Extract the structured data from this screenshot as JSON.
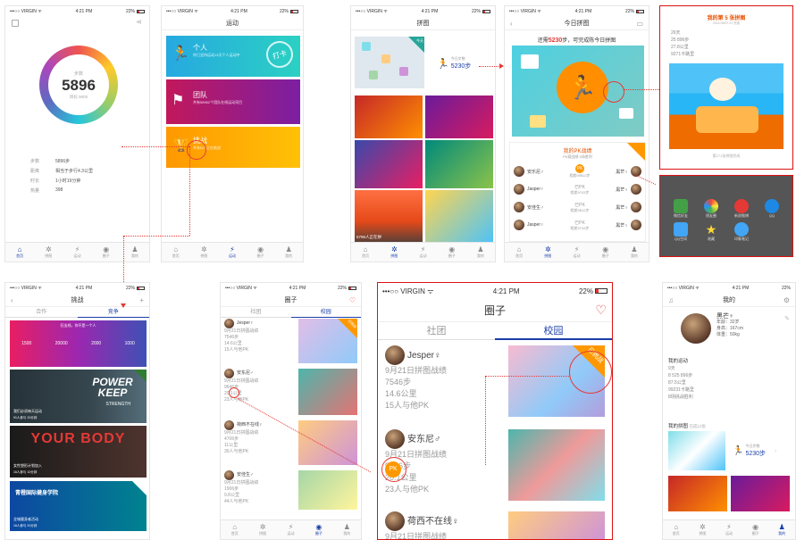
{
  "status": {
    "carrier": "•••○○ VIRGIN ᯤ",
    "time": "4:21 PM",
    "battery": "22%"
  },
  "tabs": [
    "首页",
    "拼图",
    "运动",
    "圈子",
    "我的"
  ],
  "home": {
    "steps": "5896",
    "steps_label": "步数",
    "goal": "目标 9000",
    "stats": [
      {
        "k": "步数",
        "v": "5896步"
      },
      {
        "k": "距离",
        "v": "相当于步行4.3公里"
      },
      {
        "k": "时长",
        "v": "1小时19分钟"
      },
      {
        "k": "热量",
        "v": "398"
      }
    ]
  },
  "sport": {
    "title": "运动",
    "cards": [
      {
        "title": "个人",
        "sub": "你已坚持运动13天个人运动中",
        "stamp": "打卡"
      },
      {
        "title": "团队",
        "sub": "共有58962个团队在线运动项目",
        "stamp": ""
      },
      {
        "title": "挑战",
        "sub": "共有N人正在挑战",
        "stamp": ""
      }
    ]
  },
  "puzzle": {
    "title": "拼图",
    "steps": "5230步",
    "steps_label": "今日步数",
    "badge": "今天",
    "bottom": "5796人正在拼"
  },
  "daily": {
    "title": "今日拼图",
    "banner_pre": "还需",
    "banner_num": "5230",
    "banner_post": "步，可完成陈今日拼图",
    "pk_title": "我的PK战绩",
    "pk_sub": "PK赛战绩 5场胜利",
    "pk_rows": [
      {
        "left": "安乐尼♂",
        "mid": "PK",
        "sub": "相差59812步",
        "right": "黑芒♀"
      },
      {
        "left": "Jasper♀",
        "mid": "已PK",
        "sub": "相差9743步",
        "right": "黑芒♀"
      },
      {
        "left": "安佳生♂",
        "mid": "已PK",
        "sub": "相差9812步",
        "right": "黑芒♀"
      },
      {
        "left": "Jasper♀",
        "mid": "已PK",
        "sub": "相差9743步",
        "right": "黑芒♀"
      }
    ]
  },
  "detail": {
    "title": "我的第 5 张拼图",
    "subtitle": "2014.09/07.21 完成",
    "stats": [
      "26天",
      "25 896步",
      "27.8公里",
      "9271卡路里"
    ],
    "footer": "第271张拼图完成",
    "share": [
      "微信好友",
      "朋友圈",
      "新浪微博",
      "QQ",
      "QQ空间",
      "收藏",
      "印象笔记"
    ]
  },
  "challenge": {
    "title": "挑战",
    "seg": [
      "合作",
      "竞争"
    ],
    "top_text": "狂出线，你不是一个人",
    "banners": [
      {
        "a": "1500",
        "b": "20000",
        "c": "2000",
        "d": "1000"
      },
      {
        "title": "POWER KEEP",
        "sub": "STRENGTH",
        "info": "我们必须每天运动",
        "n1": "91人参与",
        "n2": "20分钟"
      },
      {
        "title": "YOUR BODY",
        "info": "女性塑形计划加入",
        "n1": "16人参与",
        "n2": "10分钟"
      },
      {
        "title": "青橙国际健身学院",
        "info": "全城健身者活动",
        "n1": "16人参与",
        "n2": "20分钟"
      }
    ],
    "badges": [
      "已报名"
    ]
  },
  "circle_small": {
    "title": "圈子",
    "seg": [
      "社团",
      "校园"
    ],
    "items": [
      {
        "name": "Jesper♀",
        "date": "9月21日拼图战绩",
        "s1": "7546步",
        "s2": "14.6公里",
        "s3": "15人与他PK",
        "tag": "已挑战"
      },
      {
        "name": "安东尼♂",
        "date": "9月21日拼图战绩",
        "s1": "9646步",
        "s2": "20.1公里",
        "s3": "23人与他PK",
        "tag": ""
      },
      {
        "name": "荷西不在线♀",
        "date": "9月21日拼图战绩",
        "s1": "4706步",
        "s2": "11公里",
        "s3": "30人与他PK",
        "tag": ""
      },
      {
        "name": "安佳生♂",
        "date": "9月21日拼图战绩",
        "s1": "1906步",
        "s2": "9.8公里",
        "s3": "44人与他PK",
        "tag": ""
      }
    ]
  },
  "circle_big": {
    "title": "圈子",
    "seg": [
      "社团",
      "校园"
    ],
    "items": [
      {
        "name": "Jesper♀",
        "date": "9月21日拼图战绩",
        "s1": "7546步",
        "s2": "14.6公里",
        "s3": "15人与他PK",
        "tag": "已挑战"
      },
      {
        "name": "安东尼♂",
        "date": "9月21日拼图战绩",
        "s1": "9646步",
        "s2": "20.1公里",
        "s3": "23人与他PK",
        "tag": ""
      },
      {
        "name": "荷西不在线♀",
        "date": "9月21日拼图战绩",
        "s1": "",
        "s2": "",
        "s3": "",
        "tag": ""
      }
    ]
  },
  "me": {
    "title": "我的",
    "name": "黑芒♀",
    "age": "年龄：32岁",
    "height": "身高：167cm",
    "weight": "体重：50kg",
    "section1": "我的运动",
    "stats": [
      "9天",
      "8 525 896步",
      "87.5公里",
      "99231卡路里",
      "8场挑战胜利"
    ],
    "section2": "我的拼图",
    "section2_sub": "已成11张",
    "steps": "5230步",
    "steps_label": "今日步数"
  },
  "pk_badge": "PK",
  "accent_red": "#e53935",
  "accent_blue": "#1a3fa8"
}
